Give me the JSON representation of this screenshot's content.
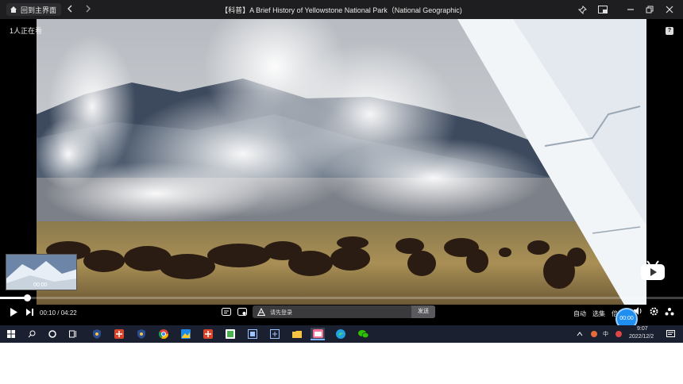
{
  "titlebar": {
    "home_label": "回到主界面",
    "title": "【科普】A Brief History of Yellowstone National Park（National Geographic)"
  },
  "overlay": {
    "viewers": "1人正在看",
    "help": "?"
  },
  "thumbnail": {
    "time": "00:00"
  },
  "player": {
    "current_time": "00:10",
    "time_separator": "/",
    "duration": "04:22",
    "progress_fraction": 0.04,
    "danmaku_placeholder": "请先登录",
    "send_label": "发送",
    "auto_label": "自动",
    "episodes_label": "选集",
    "speed_label": "倍速",
    "live_badge": "00:00"
  },
  "taskbar": {
    "clock_time": "9:07",
    "clock_date": "2022/12/2",
    "ime_label": "中"
  },
  "colors": {
    "accent_blue": "#1f8ef1",
    "bilibili_pink": "#fb7299",
    "titlebar_bg": "#1e1e20",
    "taskbar_bg": "#1b2030"
  },
  "icons": [
    "home-icon",
    "back-icon",
    "forward-icon",
    "pin-icon",
    "window-mode-icon",
    "minimize-icon",
    "restore-icon",
    "close-icon",
    "play-icon",
    "next-icon",
    "danmaku-toggle-icon",
    "danmaku-settings-icon",
    "danmaku-style-icon",
    "volume-icon",
    "settings-icon",
    "fullscreen-icon"
  ]
}
